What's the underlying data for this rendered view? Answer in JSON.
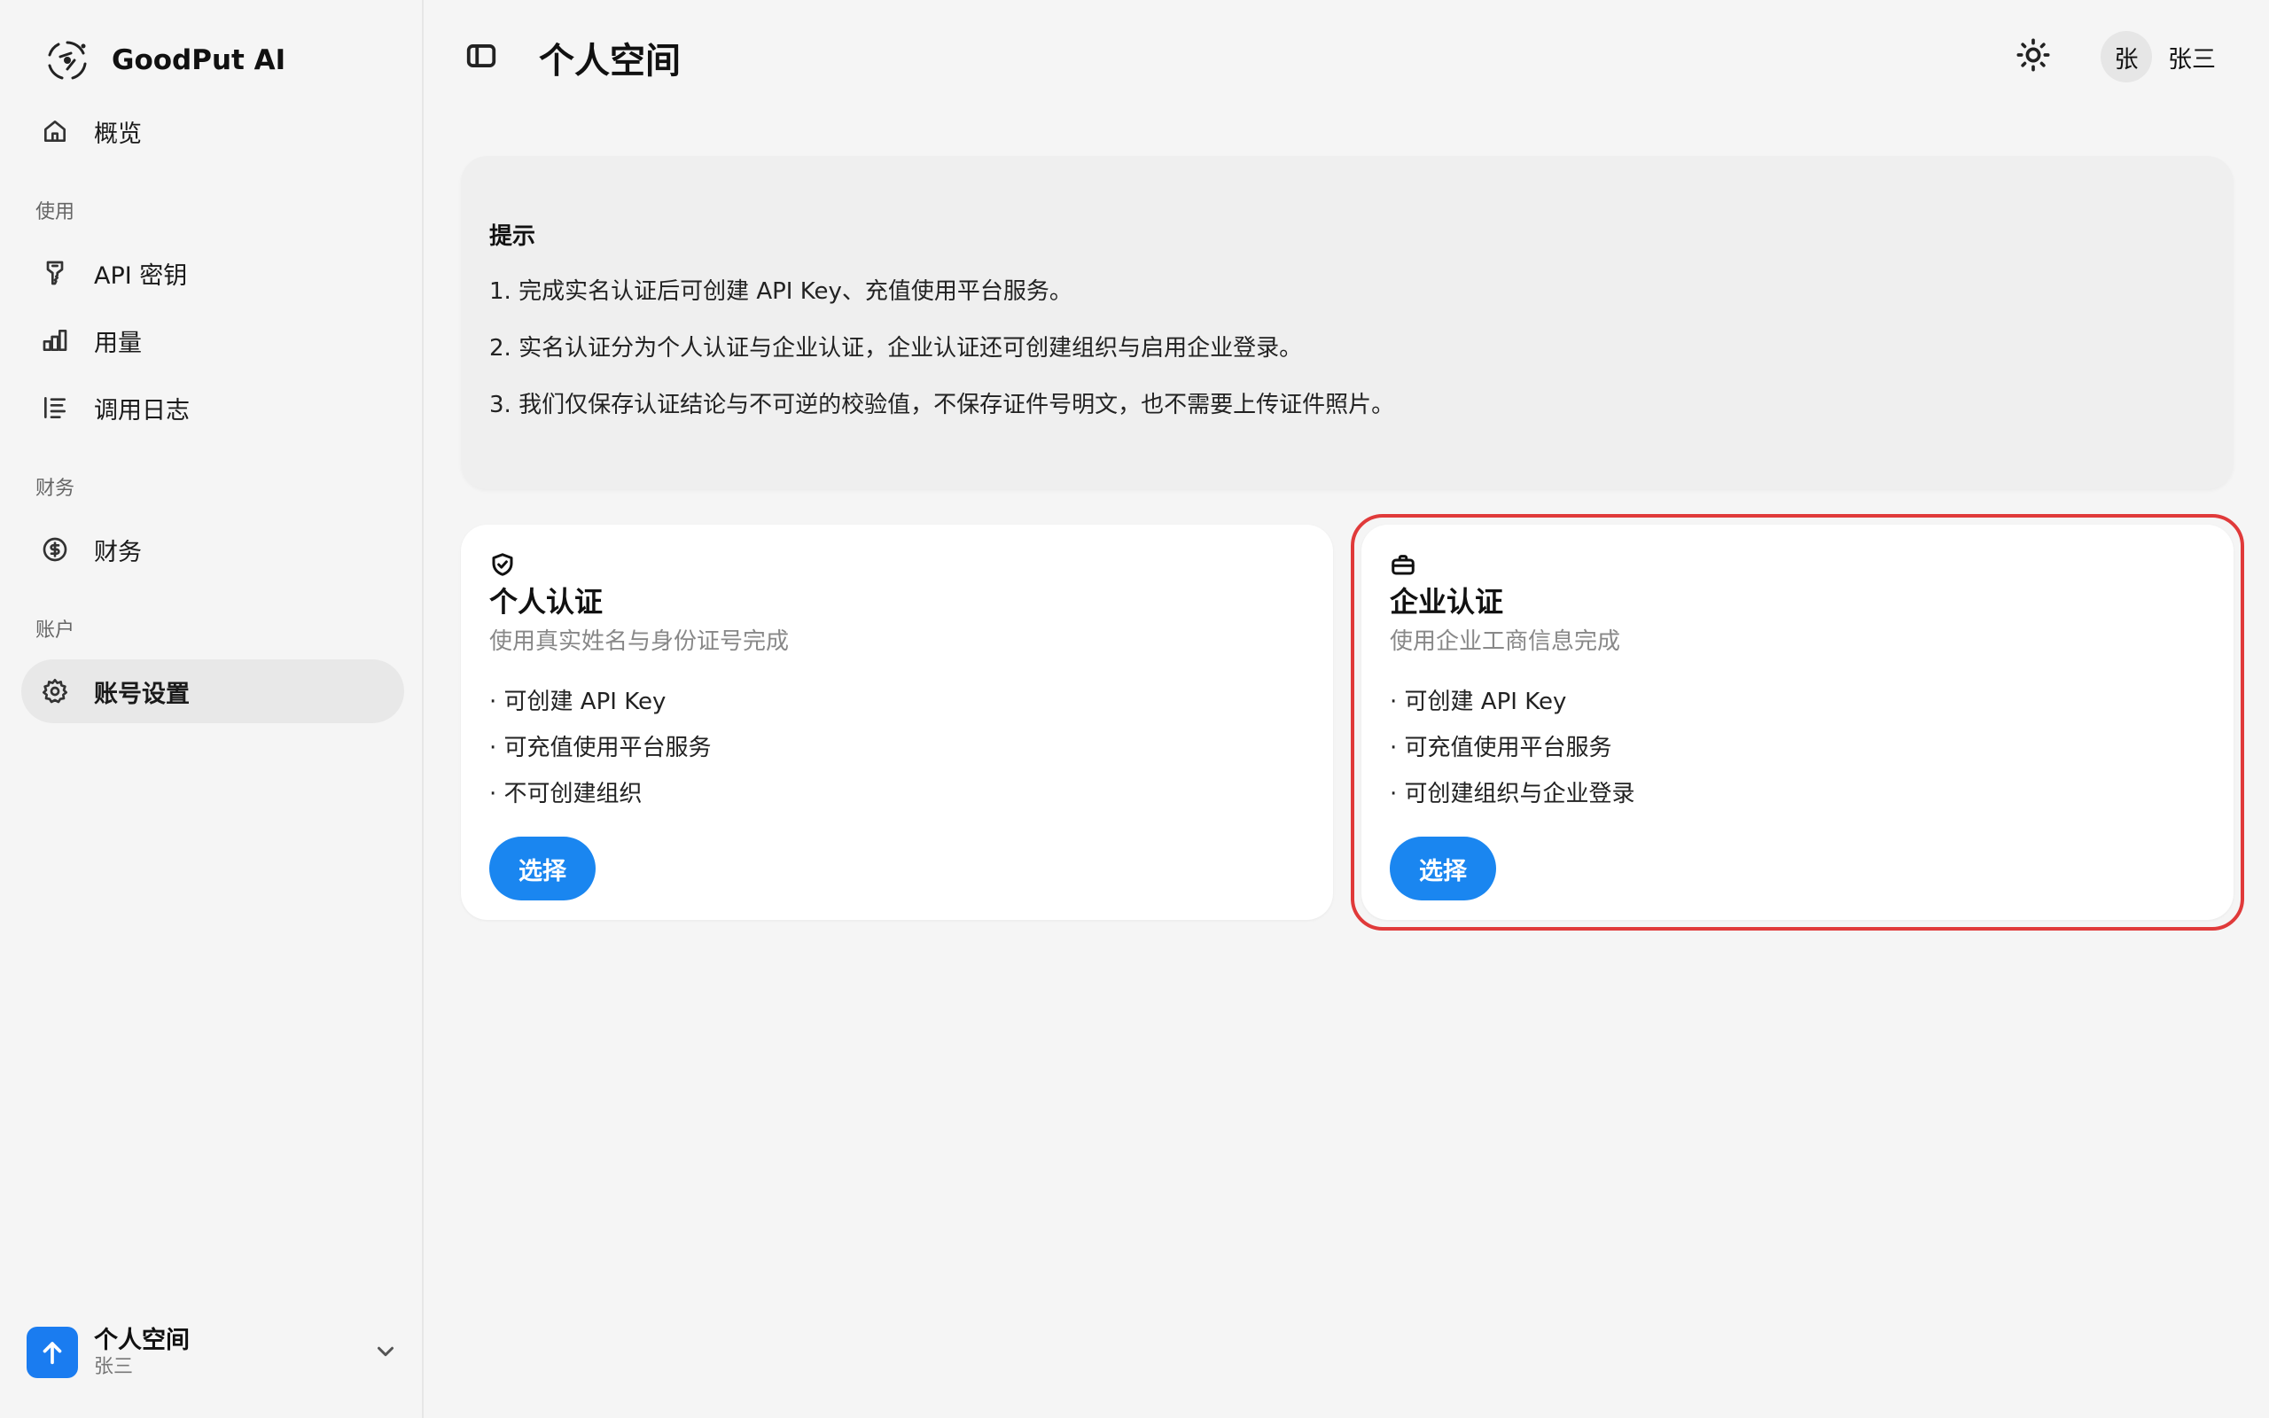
{
  "brand": {
    "name": "GoodPut AI"
  },
  "sidebar": {
    "overview": {
      "label": "概览",
      "icon": "home-icon"
    },
    "sections": [
      {
        "label": "使用",
        "items": [
          {
            "label": "API 密钥",
            "icon": "key-icon"
          },
          {
            "label": "用量",
            "icon": "bar-chart-icon"
          },
          {
            "label": "调用日志",
            "icon": "list-icon"
          }
        ]
      },
      {
        "label": "财务",
        "items": [
          {
            "label": "财务",
            "icon": "dollar-circle-icon"
          }
        ]
      },
      {
        "label": "账户",
        "items": [
          {
            "label": "账号设置",
            "icon": "gear-icon",
            "active": true
          }
        ]
      }
    ],
    "space_switcher": {
      "name": "个人空间",
      "user": "张三",
      "accent": "#1a7cf0"
    }
  },
  "header": {
    "title": "个人空间",
    "user": {
      "avatar_initial": "张",
      "name": "张三"
    }
  },
  "notice": {
    "title": "提示",
    "lines": [
      "1. 完成实名认证后可创建 API Key、充值使用平台服务。",
      "2. 实名认证分为个人认证与企业认证，企业认证还可创建组织与启用企业登录。",
      "3. 我们仅保存认证结论与不可逆的校验值，不保存证件号明文，也不需要上传证件照片。"
    ]
  },
  "cards": [
    {
      "icon": "shield-check-icon",
      "title": "个人认证",
      "subtitle": "使用真实姓名与身份证号完成",
      "features": [
        "· 可创建 API Key",
        "· 可充值使用平台服务",
        "· 不可创建组织"
      ],
      "button": "选择"
    },
    {
      "icon": "briefcase-icon",
      "title": "企业认证",
      "subtitle": "使用企业工商信息完成",
      "features": [
        "· 可创建 API Key",
        "· 可充值使用平台服务",
        "· 可创建组织与企业登录"
      ],
      "button": "选择",
      "highlighted": true
    }
  ],
  "colors": {
    "primary_button": "#1a86f0",
    "highlight_border": "#e03a3a"
  }
}
